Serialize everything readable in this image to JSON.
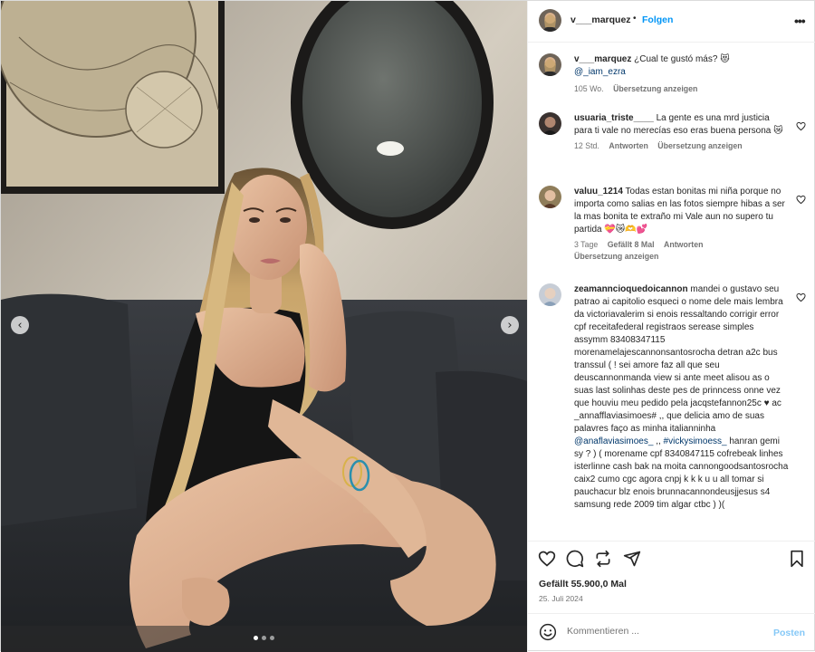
{
  "post": {
    "username": "v___marquez",
    "follow_sep": "•",
    "follow_label": "Folgen",
    "more_label": "•••",
    "photo_dots_count": 3,
    "photo_dot_active": 1
  },
  "caption": {
    "username": "v___marquez",
    "text": "¿Cual te gustó más? 😻",
    "mention": "@_iam_ezra",
    "time": "105 Wo.",
    "translate": "Übersetzung anzeigen"
  },
  "comments": [
    {
      "username": "usuaria_triste____",
      "text": "La gente es una mrd justicia para ti vale no merecías eso eras buena persona 😿",
      "time": "12 Std.",
      "reply": "Antworten",
      "translate": "Übersetzung anzeigen"
    },
    {
      "username": "valuu_1214",
      "text": "Todas estan bonitas mi niña porque no importa como salias en las fotos siempre hibas a ser la mas bonita te extraño mi Vale aun no supero tu partida 💝😿🫶💕",
      "time": "3 Tage",
      "likes": "Gefällt 8 Mal",
      "reply": "Antworten",
      "translate": "Übersetzung anzeigen"
    },
    {
      "username": "zeamanncioquedoicannon",
      "text_1": "mandei o gustavo seu patrao ai capitolio esqueci o nome dele mais lembra da victoriavalerim si enois ressaltando corrigir error cpf receitafederal registraos serease simples assymm 83408347115 morenamelajescannonsantosrocha detran a2c bus transsul ( ! sei amore faz all que seu deuscannonmanda view si ante meet alisou as o suas last solinhas deste pes de prinncess onne vez que houviu meu pedido pela jacqstefannon25c ♥ ac _annafflaviasimoes# ,, que delicia amo de suas palavres faço as minha italianninha ",
      "mention_1": "@anaflaviasimoes_",
      "text_2": " ,, ",
      "mention_2": "#vickysimoess_",
      "text_3": " hanran gemi sy ? ) ( morename cpf 8340847115 cofrebeak linhes isterlinne cash bak na moita cannongoodsantosrocha caix2 cumo cgc agora cnpj k k k u u all tomar si pauchacur blz enois brunnacannondeusjjesus s4 samsung rede 2009 tim algar ctbc ) )("
    }
  ],
  "footer": {
    "likes": "Gefällt 55.900,0 Mal",
    "date": "25. Juli 2024",
    "comment_placeholder": "Kommentieren ...",
    "post_label": "Posten"
  },
  "icons": {
    "like": "heart-icon",
    "comment": "comment-bubble-icon",
    "share": "paper-plane-icon",
    "repost": "repost-icon",
    "save": "bookmark-icon",
    "emoji": "smiley-icon",
    "prev": "chevron-left-icon",
    "next": "chevron-right-icon"
  },
  "colors": {
    "link_blue": "#0095f6",
    "post_disabled": "#85c8f7",
    "muted": "#737373",
    "mention": "#00376b"
  }
}
